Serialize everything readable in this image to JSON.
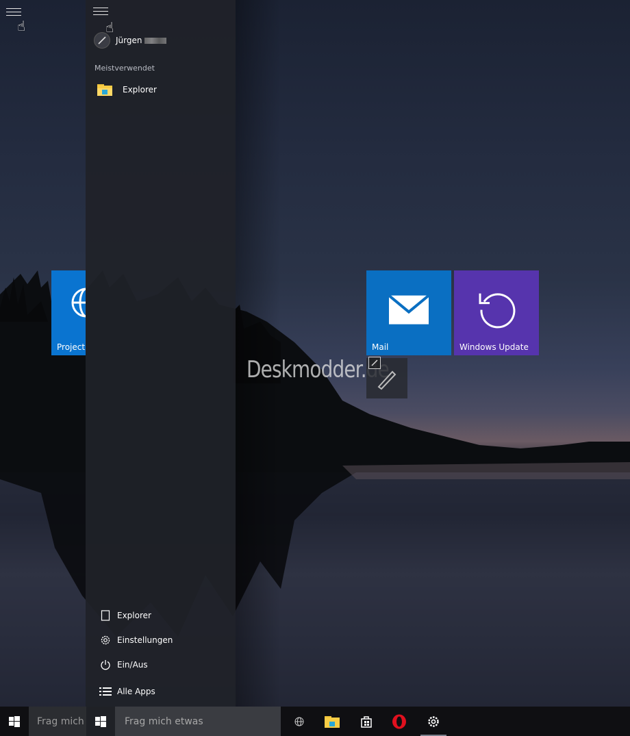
{
  "left_start": {
    "tile_project": {
      "label": "Project S"
    }
  },
  "start_menu": {
    "user": {
      "name": "Jürgen"
    },
    "most_used_header": "Meistverwendet",
    "most_used": [
      {
        "label": "Explorer",
        "icon": "folder-icon"
      }
    ],
    "bottom": [
      {
        "label": "Explorer",
        "icon": "document-icon"
      },
      {
        "label": "Einstellungen",
        "icon": "gear-icon"
      },
      {
        "label": "Ein/Aus",
        "icon": "power-icon"
      },
      {
        "label": "Alle Apps",
        "icon": "list-icon"
      }
    ]
  },
  "tiles": {
    "mail": {
      "label": "Mail",
      "color": "#0a6fc2"
    },
    "windows_update": {
      "label": "Windows Update",
      "color": "#5634ad"
    }
  },
  "watermark": "Deskmodder.de",
  "taskbar": {
    "search_left_placeholder": "Frag mich",
    "search_placeholder": "Frag mich etwas",
    "pinned": [
      "globe-icon",
      "file-explorer-icon",
      "store-icon",
      "opera-icon",
      "settings-icon"
    ]
  },
  "colors": {
    "tile_project": "#0a74d0",
    "taskbar": "#0f0f12",
    "start_panel": "#202228"
  }
}
